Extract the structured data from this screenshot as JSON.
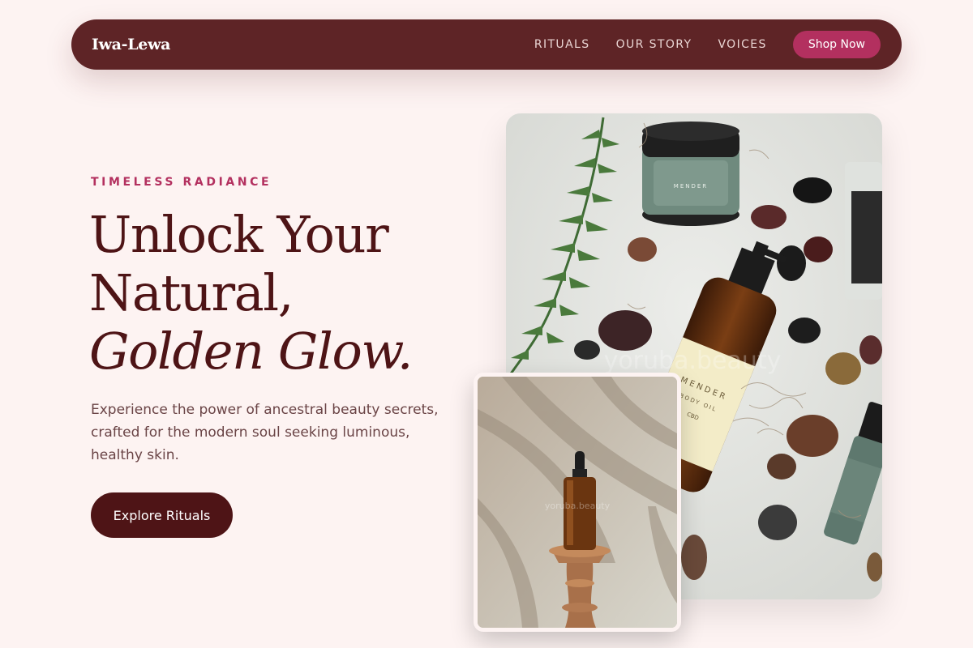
{
  "nav": {
    "brand": "Iwa-Lewa",
    "links": [
      "RITUALS",
      "OUR STORY",
      "VOICES"
    ],
    "shop_label": "Shop Now"
  },
  "hero": {
    "eyebrow": "TIMELESS RADIANCE",
    "headline_line1": "Unlock Your",
    "headline_line2": "Natural,",
    "headline_line3": "Golden Glow.",
    "subtext": "Experience the power of ancestral beauty secrets, crafted for the modern soul seeking luminous, healthy skin.",
    "cta_label": "Explore Rituals"
  },
  "images": {
    "main_watermark": "yoruba.beauty",
    "small_watermark": "yoruba.beauty"
  },
  "colors": {
    "background": "#fdf3f2",
    "nav_bg": "#5e2426",
    "accent": "#b3305f",
    "headline": "#4e1416",
    "cta_bg": "#4e1416"
  }
}
